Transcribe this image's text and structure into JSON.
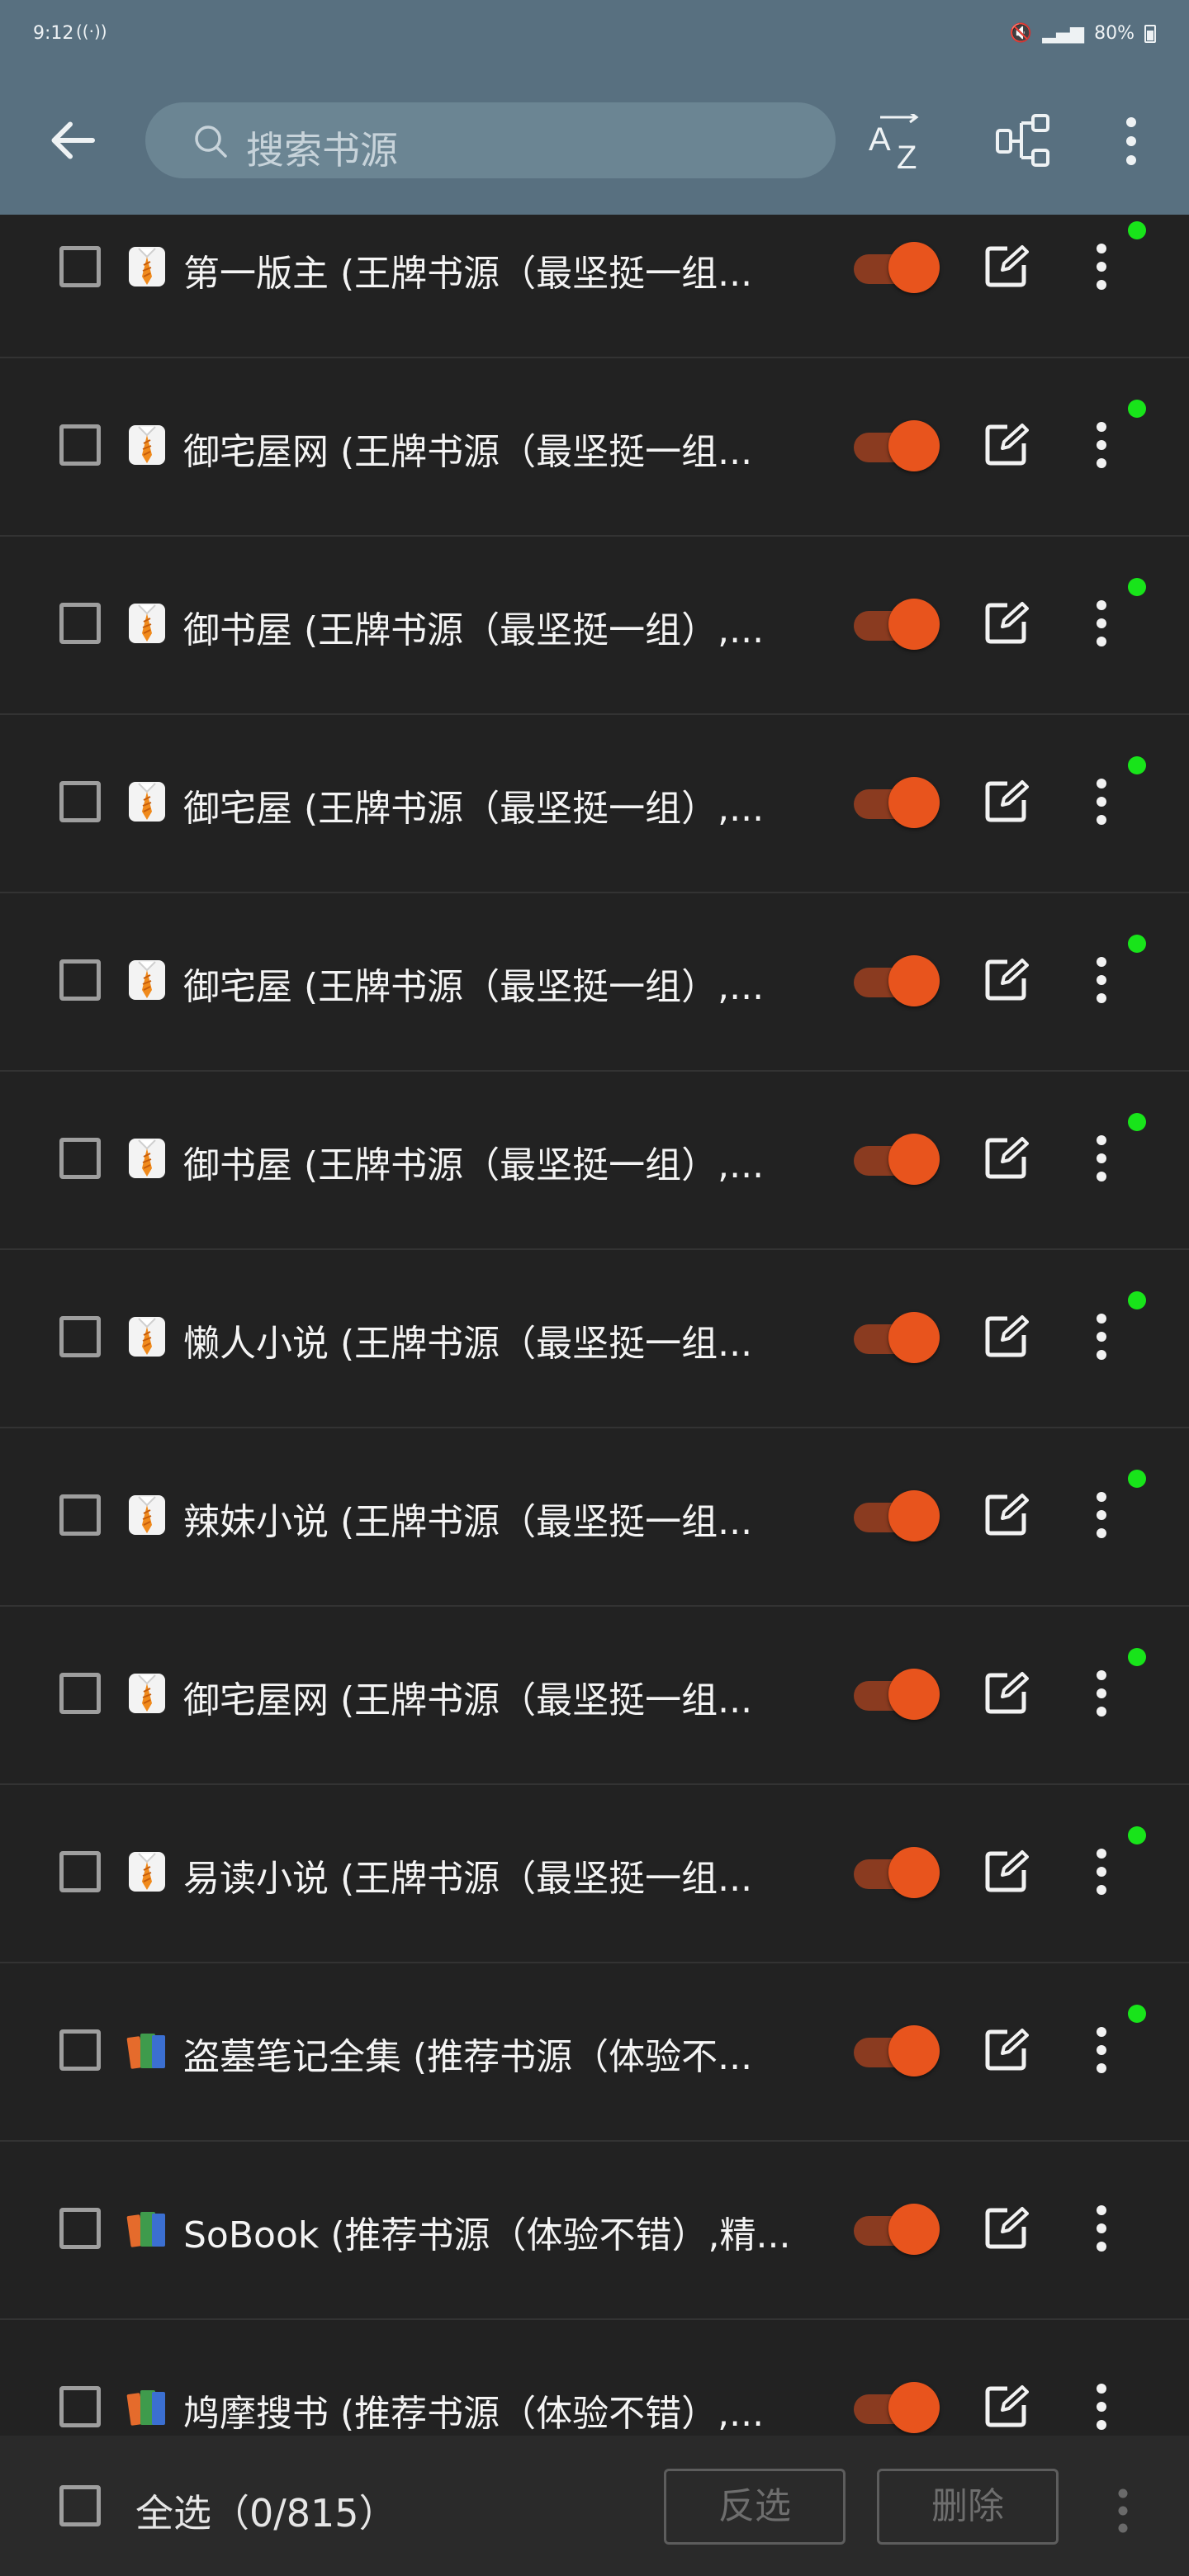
{
  "status_bar": {
    "time": "9:12",
    "battery": "80%"
  },
  "appbar": {
    "search_placeholder": "搜索书源"
  },
  "colors": {
    "toolbar": "#587080",
    "accent": "#e8541d",
    "ok_dot": "#18e41a",
    "background": "#222222"
  },
  "sources": [
    {
      "icon": "tie-emoji-icon",
      "name": "第一版主 (王牌书源（最坚挺一组...",
      "enabled": true,
      "status_dot": true
    },
    {
      "icon": "tie-emoji-icon",
      "name": "御宅屋网 (王牌书源（最坚挺一组...",
      "enabled": true,
      "status_dot": true
    },
    {
      "icon": "tie-emoji-icon",
      "name": "御书屋 (王牌书源（最坚挺一组）,...",
      "enabled": true,
      "status_dot": true
    },
    {
      "icon": "tie-emoji-icon",
      "name": "御宅屋 (王牌书源（最坚挺一组）,...",
      "enabled": true,
      "status_dot": true
    },
    {
      "icon": "tie-emoji-icon",
      "name": "御宅屋 (王牌书源（最坚挺一组）,...",
      "enabled": true,
      "status_dot": true
    },
    {
      "icon": "tie-emoji-icon",
      "name": "御书屋 (王牌书源（最坚挺一组）,...",
      "enabled": true,
      "status_dot": true
    },
    {
      "icon": "tie-emoji-icon",
      "name": "懒人小说 (王牌书源（最坚挺一组...",
      "enabled": true,
      "status_dot": true
    },
    {
      "icon": "tie-emoji-icon",
      "name": "辣妹小说 (王牌书源（最坚挺一组...",
      "enabled": true,
      "status_dot": true
    },
    {
      "icon": "tie-emoji-icon",
      "name": "御宅屋网 (王牌书源（最坚挺一组...",
      "enabled": true,
      "status_dot": true
    },
    {
      "icon": "tie-emoji-icon",
      "name": "易读小说 (王牌书源（最坚挺一组...",
      "enabled": true,
      "status_dot": true
    },
    {
      "icon": "books-emoji-icon",
      "name": "盗墓笔记全集 (推荐书源（体验不...",
      "enabled": true,
      "status_dot": true
    },
    {
      "icon": "books-emoji-icon",
      "name": "SoBook (推荐书源（体验不错）,精...",
      "enabled": true,
      "status_dot": false
    },
    {
      "icon": "books-emoji-icon",
      "name": "鸠摩搜书 (推荐书源（体验不错）,...",
      "enabled": true,
      "status_dot": false
    }
  ],
  "bottom_bar": {
    "select_all_label": "全选（0/815）",
    "invert_label": "反选",
    "delete_label": "删除"
  }
}
